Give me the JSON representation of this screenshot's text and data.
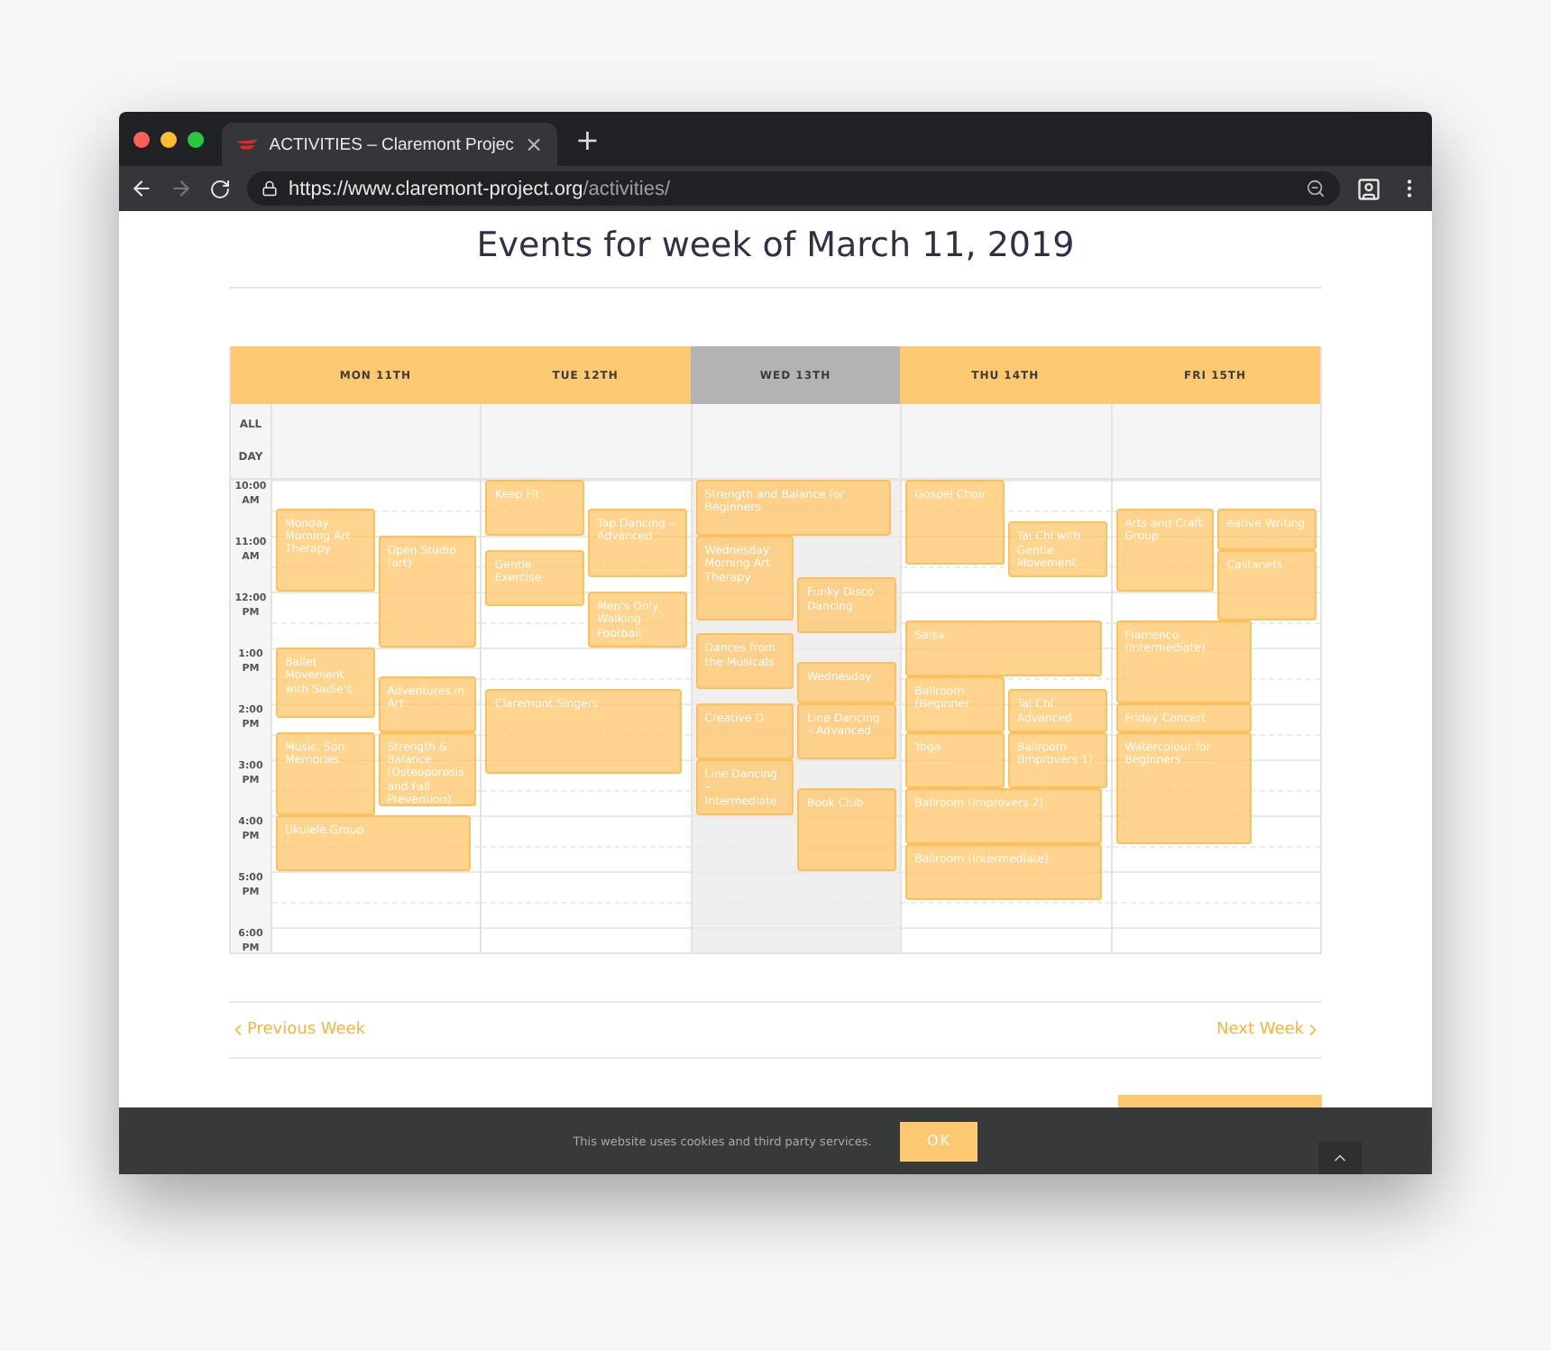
{
  "browser": {
    "tab_title": "ACTIVITIES – Claremont Projec",
    "tab_close": "×",
    "new_tab": "+",
    "forward_disabled": true,
    "url_host": "https://www.claremont-project.org",
    "url_path": "/activities/"
  },
  "page": {
    "title": "Events for week of March 11, 2019",
    "calendar": {
      "all_day_label": "ALL DAY",
      "hours": [
        "10:00 AM",
        "11:00 AM",
        "12:00 PM",
        "1:00 PM",
        "2:00 PM",
        "3:00 PM",
        "4:00 PM",
        "5:00 PM",
        "6:00 PM"
      ],
      "days": [
        {
          "label": "MON 11TH",
          "today": false,
          "events": [
            {
              "title": "Monday Morning Art Therapy"
            },
            {
              "title": "Open Studio (art)"
            },
            {
              "title": "Ballet Movement with Sadie's"
            },
            {
              "title": "Adventures in Art"
            },
            {
              "title": "Music, Son Memories"
            },
            {
              "title": "Strength & Balance (Osteoporosis and Fall Prevention)"
            },
            {
              "title": "Ukulele Group"
            }
          ]
        },
        {
          "label": "TUE 12TH",
          "today": false,
          "events": [
            {
              "title": "Keep Fit"
            },
            {
              "title": "Tap Dancing – Advanced"
            },
            {
              "title": "Gentle Exercise"
            },
            {
              "title": "Men's Only Walking Football"
            },
            {
              "title": "Claremont Singers"
            }
          ]
        },
        {
          "label": "WED 13TH",
          "today": true,
          "events": [
            {
              "title": "Strength and Balance for Beginners"
            },
            {
              "title": "Wednesday Morning Art Therapy"
            },
            {
              "title": "Funky Disco Dancing"
            },
            {
              "title": "Dances from the Musicals"
            },
            {
              "title": "Wednesday"
            },
            {
              "title": "Creative D"
            },
            {
              "title": "Line Dancing – Advanced"
            },
            {
              "title": "Line Dancing – Intermediate"
            },
            {
              "title": "Book Club"
            }
          ]
        },
        {
          "label": "THU 14TH",
          "today": false,
          "events": [
            {
              "title": "Gospel Choir"
            },
            {
              "title": "Tai Chi with Gentle Movement"
            },
            {
              "title": "Salsa"
            },
            {
              "title": "Ballroom (Beginner"
            },
            {
              "title": "Tai Chi Advanced"
            },
            {
              "title": "Yoga"
            },
            {
              "title": "Ballroom (Improvers 1)"
            },
            {
              "title": "Ballroom (Improvers 2)"
            },
            {
              "title": "Ballroom (Intermediate)"
            }
          ]
        },
        {
          "label": "FRI 15TH",
          "today": false,
          "events": [
            {
              "title": "Arts and Craft Group"
            },
            {
              "title": "eative Writing"
            },
            {
              "title": "Castanets"
            },
            {
              "title": "Flamenco (Intermediate)"
            },
            {
              "title": "Friday Concert"
            },
            {
              "title": "Watercolour for Beginners"
            }
          ]
        }
      ]
    },
    "nav": {
      "previous": "Previous Week",
      "next": "Next Week"
    }
  },
  "cookie_bar": {
    "text": "This website uses cookies and third party services.",
    "button": "OK"
  }
}
